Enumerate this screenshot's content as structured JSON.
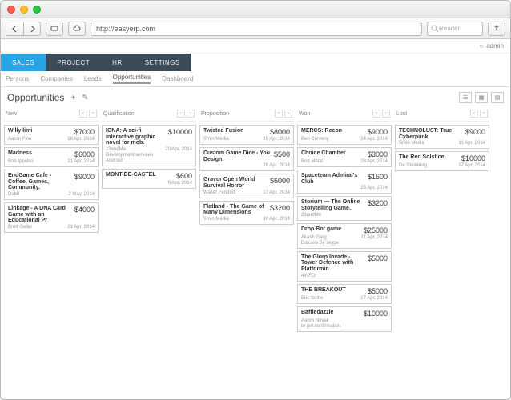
{
  "browser": {
    "url": "http://easyerp.com",
    "searchPlaceholder": "Reader"
  },
  "user": {
    "name": "admin"
  },
  "mainTabs": [
    "SALES",
    "PROJECT",
    "HR",
    "SETTINGS"
  ],
  "activeMainTab": "SALES",
  "subTabs": [
    "Persons",
    "Companies",
    "Leads",
    "Opportunities",
    "Dashboard"
  ],
  "activeSubTab": "Opportunities",
  "pageTitle": "Opportunities",
  "columns": [
    {
      "name": "New",
      "cards": [
        {
          "title": "Willy limi",
          "amount": "$7000",
          "owner": "Aaron Fine",
          "date": "18 Apr, 2014"
        },
        {
          "title": "Madness",
          "amount": "$6000",
          "owner": "Bob Ippolito",
          "date": "21 Apr, 2014"
        },
        {
          "title": "EndGame Cafe - Coffee, Games, Community.",
          "amount": "$9000",
          "owner": "Dubit",
          "date": "2 May, 2014"
        },
        {
          "title": "Linkage - A DNA Card Game with an Educational Pr",
          "amount": "$4000",
          "owner": "Brett Geller",
          "date": "21 Apr, 2014"
        }
      ]
    },
    {
      "name": "Qualification",
      "cards": [
        {
          "title": "IONA: A sci-fi interactive graphic novel for mob.",
          "amount": "$10000",
          "owner": "23andMe",
          "date": "20 Apr, 2014",
          "extra": "Development services",
          "extra2": "Android"
        },
        {
          "title": "MONT-DE-CASTEL",
          "amount": "$600",
          "owner": "",
          "date": "6 Apr, 2014"
        }
      ]
    },
    {
      "name": "Proposition",
      "cards": [
        {
          "title": "Twisted Fusion",
          "amount": "$8000",
          "owner": "Smin Media",
          "date": "19 Apr, 2014"
        },
        {
          "title": "Custom Game Dice - You Design.",
          "amount": "$500",
          "owner": "",
          "date": "28 Apr, 2014"
        },
        {
          "title": "Gravor Open World Survival Horror",
          "amount": "$6000",
          "owner": "Walter Fendon",
          "date": "17 Apr, 2014"
        },
        {
          "title": "Flatland - The Game of Many Dimensions",
          "amount": "$3200",
          "owner": "Smin Media",
          "date": "30 Apr, 2014"
        }
      ]
    },
    {
      "name": "Won",
      "cards": [
        {
          "title": "MERCS: Recon",
          "amount": "$9000",
          "owner": "Ben Cerveny",
          "date": "24 Apr, 2014"
        },
        {
          "title": "Choice Chamber",
          "amount": "$3000",
          "owner": "Bob Metal",
          "date": "28 Apr, 2014"
        },
        {
          "title": "Spaceteam Admiral's Club",
          "amount": "$1600",
          "owner": "",
          "date": "26 Apr, 2014"
        },
        {
          "title": "Storium — The Online Storytelling Game.",
          "amount": "$3200",
          "owner": "23andMe",
          "date": ""
        },
        {
          "title": "Drop Bot game",
          "amount": "$25000",
          "owner": "Akash Garg",
          "date": "11 Apr, 2014",
          "extra": "Discuss By skype"
        },
        {
          "title": "The Glorp Invade - Tower Defence with Platformin",
          "amount": "$5000",
          "owner": "4INFO",
          "date": ""
        },
        {
          "title": "THE BREAKOUT",
          "amount": "$5000",
          "owner": "Eric Settle",
          "date": "17 Apr, 2014"
        },
        {
          "title": "Baffledazzle",
          "amount": "$10000",
          "owner": "Aaron Novak",
          "date": "",
          "extra": "to get confirmation"
        }
      ]
    },
    {
      "name": "Lost",
      "cards": [
        {
          "title": "TECHNOLUST: True Cyberpunk",
          "amount": "$9000",
          "owner": "Smin Media",
          "date": "11 Apr, 2014"
        },
        {
          "title": "The Red Solstice",
          "amount": "$10000",
          "owner": "De Steinberg",
          "date": "17 Apr, 2014"
        }
      ]
    }
  ]
}
